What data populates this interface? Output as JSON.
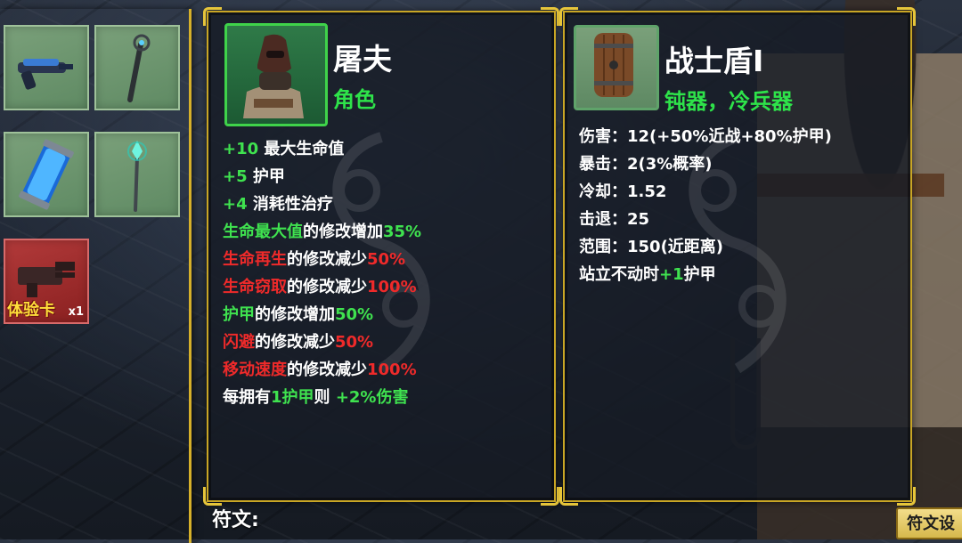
{
  "inventory": {
    "slots": [
      {
        "icon": "blaster-pistol-icon"
      },
      {
        "icon": "magic-staff-icon"
      },
      {
        "icon": "energy-canister-icon"
      },
      {
        "icon": "crystal-wand-icon"
      },
      {
        "icon": "minigun-icon",
        "badge": "体验卡",
        "count": "x1"
      }
    ]
  },
  "character": {
    "name": "屠夫",
    "type": "角色",
    "portrait_icon": "butcher-portrait-icon",
    "lines": [
      [
        {
          "t": "+10",
          "c": "g"
        },
        {
          "t": " 最大生命值",
          "c": "w"
        }
      ],
      [
        {
          "t": "+5",
          "c": "g"
        },
        {
          "t": " 护甲",
          "c": "w"
        }
      ],
      [
        {
          "t": "+4",
          "c": "g"
        },
        {
          "t": " 消耗性治疗",
          "c": "w"
        }
      ],
      [
        {
          "t": "生命最大值",
          "c": "g"
        },
        {
          "t": "的修改增加",
          "c": "w"
        },
        {
          "t": "35%",
          "c": "g"
        }
      ],
      [
        {
          "t": "生命再生",
          "c": "r"
        },
        {
          "t": "的修改减少",
          "c": "w"
        },
        {
          "t": "50%",
          "c": "r"
        }
      ],
      [
        {
          "t": "生命窃取",
          "c": "r"
        },
        {
          "t": "的修改减少",
          "c": "w"
        },
        {
          "t": "100%",
          "c": "r"
        }
      ],
      [
        {
          "t": "护甲",
          "c": "g"
        },
        {
          "t": "的修改增加",
          "c": "w"
        },
        {
          "t": "50%",
          "c": "g"
        }
      ],
      [
        {
          "t": "闪避",
          "c": "r"
        },
        {
          "t": "的修改减少",
          "c": "w"
        },
        {
          "t": "50%",
          "c": "r"
        }
      ],
      [
        {
          "t": "移动速度",
          "c": "r"
        },
        {
          "t": "的修改减少",
          "c": "w"
        },
        {
          "t": "100%",
          "c": "r"
        }
      ],
      [
        {
          "t": "每拥有",
          "c": "w"
        },
        {
          "t": "1护甲",
          "c": "g"
        },
        {
          "t": "则 ",
          "c": "w"
        },
        {
          "t": "+2%伤害",
          "c": "g"
        }
      ]
    ]
  },
  "weapon": {
    "name": "战士盾I",
    "type": "钝器，冷兵器",
    "icon": "wooden-shield-icon",
    "stats": [
      [
        {
          "t": "伤害：12(+50%近战+80%护甲)",
          "c": "w"
        }
      ],
      [
        {
          "t": "暴击：2(3%概率)",
          "c": "w"
        }
      ],
      [
        {
          "t": "冷却：1.52",
          "c": "w"
        }
      ],
      [
        {
          "t": "击退：25",
          "c": "w"
        }
      ],
      [
        {
          "t": "范围：150(近距离)",
          "c": "w"
        }
      ],
      [
        {
          "t": "站立不动时",
          "c": "w"
        },
        {
          "t": "+1",
          "c": "g"
        },
        {
          "t": "护甲",
          "c": "w"
        }
      ]
    ]
  },
  "footer": {
    "runes_label": "符文:",
    "runes_button": "符文设"
  },
  "colors": {
    "frame_gold": "#c9a625",
    "positive_green": "#3fe24f",
    "negative_red": "#ef2a2a"
  }
}
